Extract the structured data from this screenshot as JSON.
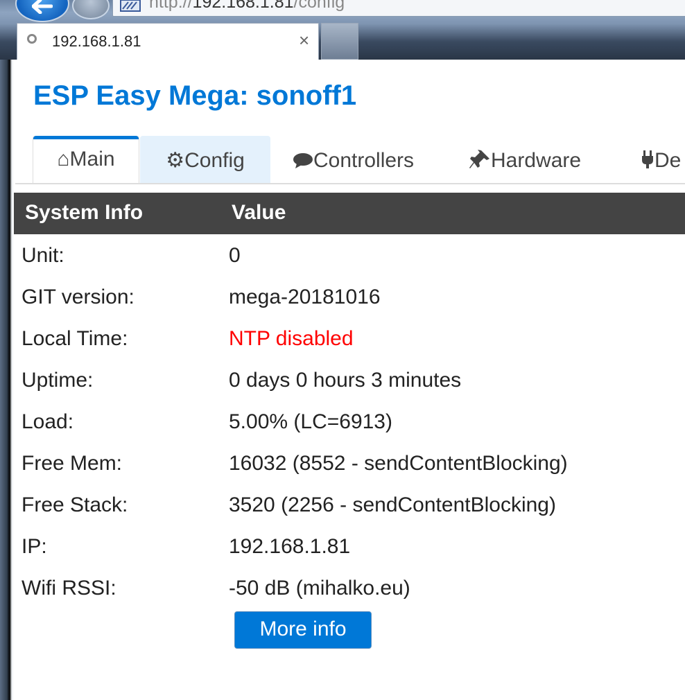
{
  "browser": {
    "address_host": "192.168.1.81",
    "address_path": "/config",
    "address_prefix": "http://",
    "tab_title": "192.168.1.81",
    "tab_close": "×"
  },
  "page": {
    "title": "ESP Easy Mega: sonoff1"
  },
  "menu": {
    "items": [
      {
        "icon": "⌂",
        "label": "Main"
      },
      {
        "icon": "⚙",
        "label": "Config"
      },
      {
        "icon": "💬",
        "label": "Controllers"
      },
      {
        "icon": "📌",
        "label": "Hardware"
      },
      {
        "icon": "🔌",
        "label": "De"
      }
    ]
  },
  "table": {
    "headers": [
      "System Info",
      "Value"
    ],
    "rows": [
      {
        "label": "Unit:",
        "value": "0"
      },
      {
        "label": "GIT version:",
        "value": "mega-20181016"
      },
      {
        "label": "Local Time:",
        "value": "NTP disabled"
      },
      {
        "label": "Uptime:",
        "value": "0 days 0 hours 3 minutes"
      },
      {
        "label": "Load:",
        "value": "5.00% (LC=6913)"
      },
      {
        "label": "Free Mem:",
        "value": "16032 (8552 - sendContentBlocking)"
      },
      {
        "label": "Free Stack:",
        "value": "3520 (2256 - sendContentBlocking)"
      },
      {
        "label": "IP:",
        "value": "192.168.1.81"
      },
      {
        "label": "Wifi RSSI:",
        "value": "-50 dB (mihalko.eu)"
      }
    ]
  },
  "more_info_button": "More info",
  "colors": {
    "accent": "#0078d7",
    "header_bg": "#444444",
    "warning": "#ff0000"
  }
}
